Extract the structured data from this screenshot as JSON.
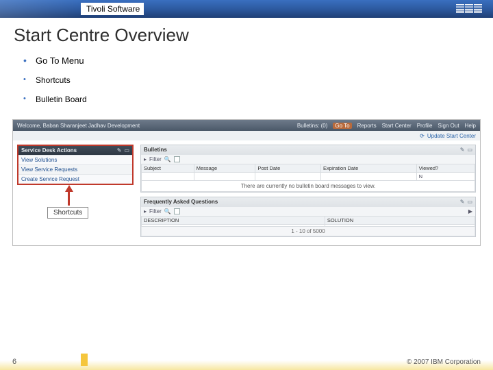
{
  "banner": {
    "brand": "Tivoli Software",
    "logo": "IBM"
  },
  "title": "Start Centre Overview",
  "bullets": {
    "b1": "Go To Menu",
    "b2": "Shortcuts",
    "b3": "Bulletin Board"
  },
  "shot": {
    "welcome": "Welcome, Baban Sharanjeet Jadhav Development",
    "nav": {
      "bulletins": "Bulletins: (0)",
      "goto": "Go To",
      "reports": "Reports",
      "startcenter": "Start Center",
      "profile": "Profile",
      "signout": "Sign Out",
      "help": "Help"
    },
    "update_link": "Update Start Center",
    "left_panel": {
      "title": "Service Desk Actions",
      "r1": "View Solutions",
      "r2": "View Service Requests",
      "r3": "Create Service Request"
    },
    "bulletins_panel": {
      "title": "Bulletins",
      "filter": "Filter",
      "cols": {
        "subject": "Subject",
        "message": "Message",
        "postdate": "Post Date",
        "expiration": "Expiration Date",
        "viewed": "Viewed?"
      },
      "empty": "There are currently no bulletin board messages to view."
    },
    "faq_panel": {
      "title": "Frequently Asked Questions",
      "filter": "Filter",
      "cols": {
        "description": "DESCRIPTION",
        "solution": "SOLUTION"
      },
      "range": "1 - 10 of 5000"
    }
  },
  "callout": {
    "label": "Shortcuts"
  },
  "footer": {
    "page": "6",
    "copyright": "© 2007 IBM Corporation"
  }
}
